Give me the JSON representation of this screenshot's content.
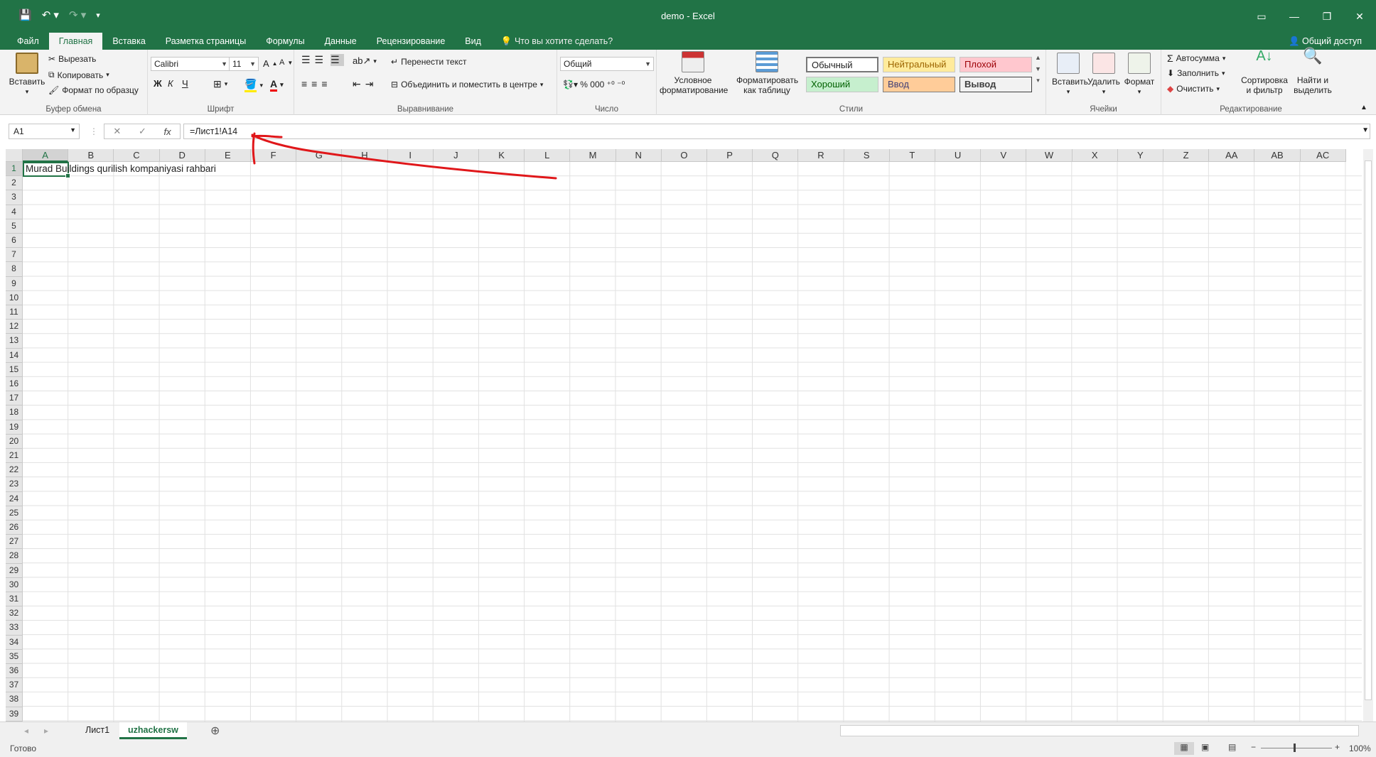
{
  "app": {
    "title": "demo - Excel"
  },
  "menu": {
    "tabs": [
      "Файл",
      "Главная",
      "Вставка",
      "Разметка страницы",
      "Формулы",
      "Данные",
      "Рецензирование",
      "Вид"
    ],
    "tell_me": "Что вы хотите сделать?",
    "share": "Общий доступ"
  },
  "ribbon": {
    "clipboard": {
      "paste": "Вставить",
      "cut": "Вырезать",
      "copy": "Копировать",
      "format_painter": "Формат по образцу",
      "label": "Буфер обмена"
    },
    "font": {
      "name": "Calibri",
      "size": "11",
      "bold": "Ж",
      "italic": "К",
      "underline": "Ч",
      "label": "Шрифт"
    },
    "alignment": {
      "wrap": "Перенести текст",
      "merge": "Объединить и поместить в центре",
      "label": "Выравнивание"
    },
    "number": {
      "format": "Общий",
      "label": "Число"
    },
    "styles": {
      "conditional": [
        "Условное",
        "форматирование"
      ],
      "as_table": [
        "Форматировать",
        "как таблицу"
      ],
      "cells": [
        "Обычный",
        "Нейтральный",
        "Плохой",
        "Хороший",
        "Ввод",
        "Вывод"
      ],
      "label": "Стили"
    },
    "cells": {
      "insert": "Вставить",
      "delete": "Удалить",
      "format": "Формат",
      "label": "Ячейки"
    },
    "editing": {
      "autosum": "Автосумма",
      "fill": "Заполнить",
      "clear": "Очистить",
      "sort": [
        "Сортировка",
        "и фильтр"
      ],
      "find": [
        "Найти и",
        "выделить"
      ],
      "label": "Редактирование"
    }
  },
  "formula_bar": {
    "name_box": "A1",
    "formula": "=Лист1!A14",
    "fx": "fx"
  },
  "sheet": {
    "columns": [
      "A",
      "B",
      "C",
      "D",
      "E",
      "F",
      "G",
      "H",
      "I",
      "J",
      "K",
      "L",
      "M",
      "N",
      "O",
      "P",
      "Q",
      "R",
      "S",
      "T",
      "U",
      "V",
      "W",
      "X",
      "Y",
      "Z",
      "AA",
      "AB",
      "AC"
    ],
    "rows": [
      "1",
      "2",
      "3",
      "4",
      "5",
      "6",
      "7",
      "8",
      "9",
      "10",
      "11",
      "12",
      "13",
      "14",
      "15",
      "16",
      "17",
      "18",
      "19",
      "20",
      "21",
      "22",
      "23",
      "24",
      "25",
      "26",
      "27",
      "28",
      "29",
      "30",
      "31",
      "32",
      "33",
      "34",
      "35",
      "36",
      "37",
      "38",
      "39"
    ],
    "a1_value": "Murad Buildings qurilish kompaniyasi rahbari"
  },
  "sheet_tabs": [
    "Лист1",
    "uzhackersw"
  ],
  "status": {
    "ready": "Готово",
    "zoom": "100%"
  },
  "colors": {
    "accent": "#217346",
    "annotation": "#e0171a"
  }
}
